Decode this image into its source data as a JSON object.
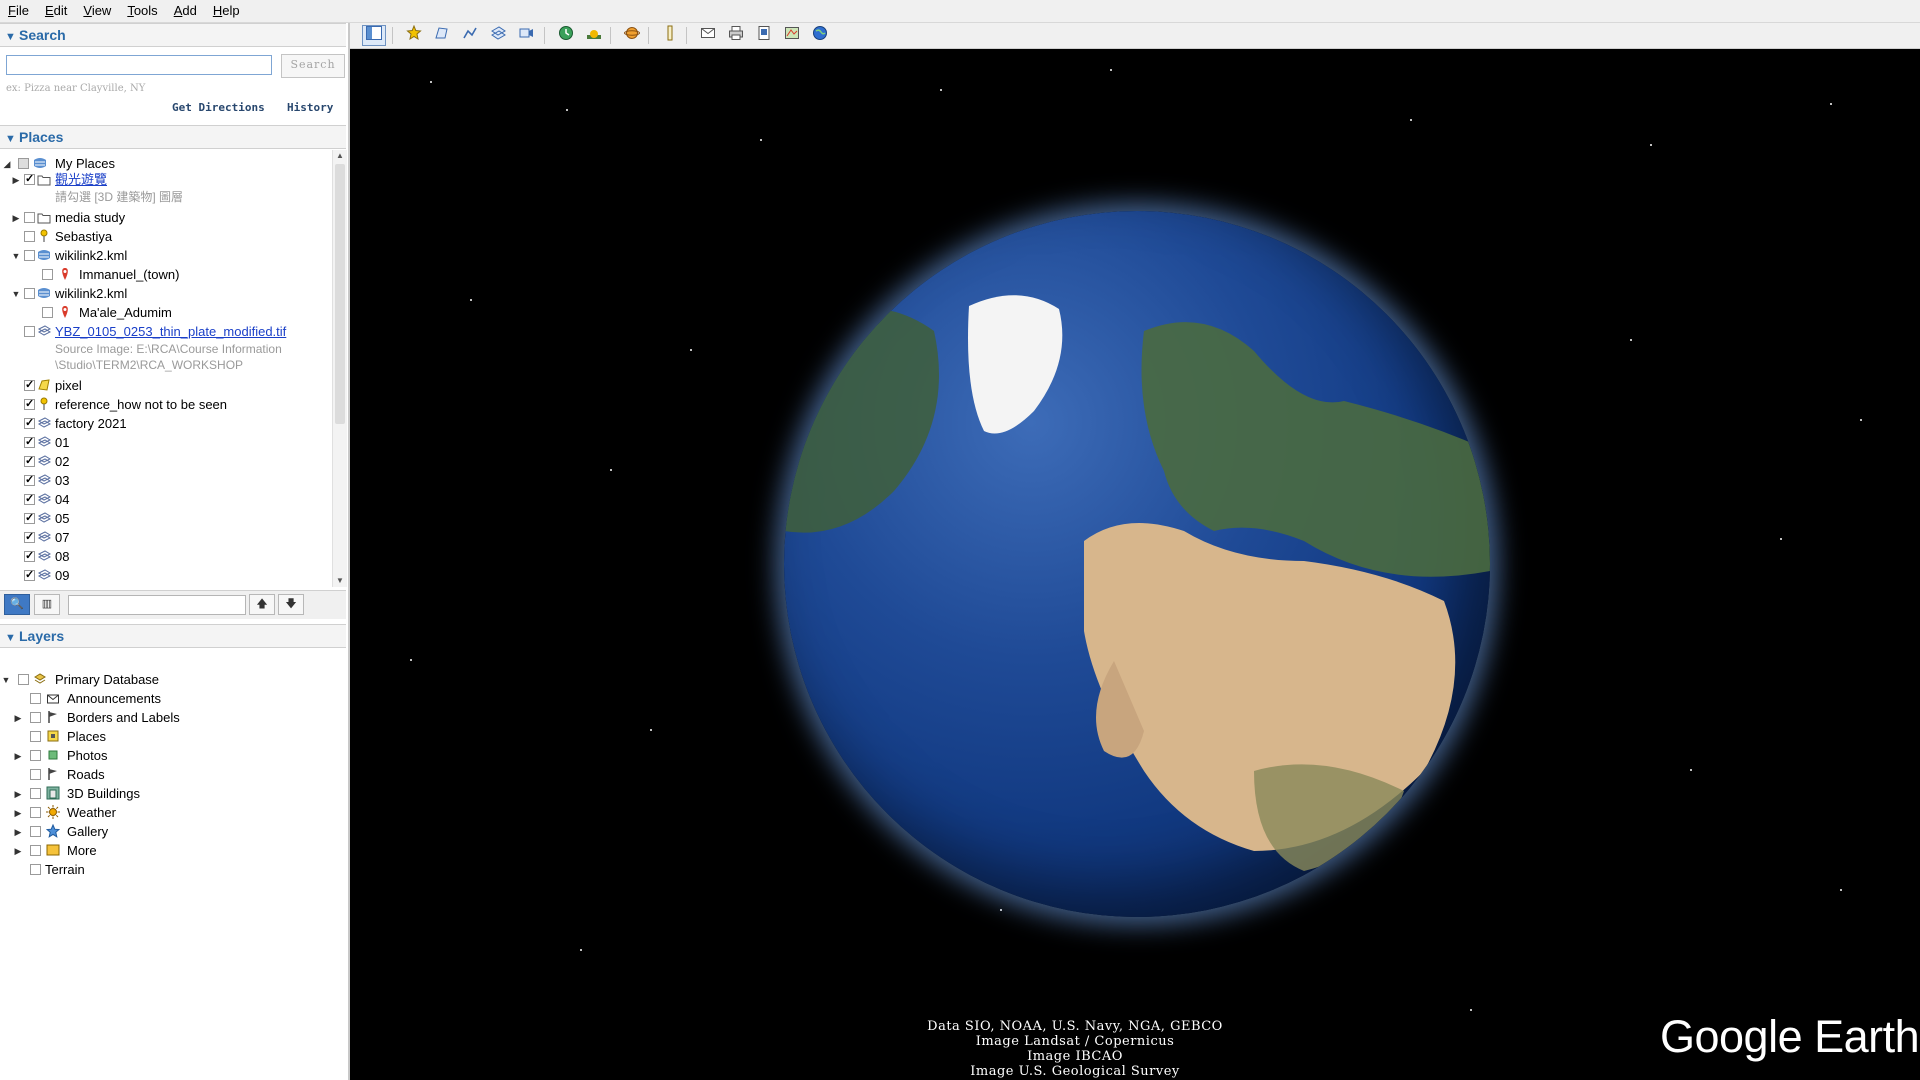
{
  "menubar": {
    "items": [
      "File",
      "Edit",
      "View",
      "Tools",
      "Add",
      "Help"
    ]
  },
  "search": {
    "header": "Search",
    "input_value": "",
    "search_button": "Search",
    "hint": "ex: Pizza near Clayville, NY",
    "get_directions": "Get Directions",
    "history": "History"
  },
  "places": {
    "header": "Places",
    "items": [
      {
        "label": "My Places"
      },
      {
        "label": "觀光遊覽"
      },
      {
        "label": "media study"
      },
      {
        "label": "Sebastiya"
      },
      {
        "label": "wikilink2.kml"
      },
      {
        "label": "Immanuel_(town)"
      },
      {
        "label": "wikilink2.kml"
      },
      {
        "label": "Ma'ale_Adumim"
      },
      {
        "label": "YBZ_0105_0253_thin_plate_modified.tif"
      },
      {
        "label": "pixel"
      },
      {
        "label": "reference_how not to be seen"
      },
      {
        "label": "factory 2021"
      },
      {
        "label": "01"
      },
      {
        "label": "02"
      },
      {
        "label": "03"
      },
      {
        "label": "04"
      },
      {
        "label": "05"
      },
      {
        "label": "07"
      },
      {
        "label": "08"
      },
      {
        "label": "09"
      }
    ],
    "tour_hint": "請勾選 [3D 建築物] 圖層",
    "source_line1": "Source Image: E:\\RCA\\Course Information",
    "source_line2": "\\Studio\\TERM2\\RCA_WORKSHOP"
  },
  "layers": {
    "header": "Layers",
    "items": [
      {
        "label": "Primary Database"
      },
      {
        "label": "Announcements"
      },
      {
        "label": "Borders and Labels"
      },
      {
        "label": "Places"
      },
      {
        "label": "Photos"
      },
      {
        "label": "Roads"
      },
      {
        "label": "3D Buildings"
      },
      {
        "label": "Weather"
      },
      {
        "label": "Gallery"
      },
      {
        "label": "More"
      },
      {
        "label": "Terrain"
      }
    ]
  },
  "toolbar_icons": [
    "sidebar-toggle-icon",
    "placemark-icon",
    "polygon-icon",
    "path-icon",
    "image-overlay-icon",
    "record-tour-icon",
    "historical-imagery-icon",
    "sunlight-icon",
    "planets-icon",
    "ruler-icon",
    "email-icon",
    "print-icon",
    "save-image-icon",
    "view-in-maps-icon",
    "earth-gallery-icon"
  ],
  "credits": {
    "line1": "Data SIO, NOAA, U.S. Navy, NGA, GEBCO",
    "line2": "Image Landsat / Copernicus",
    "line3": "Image IBCAO",
    "line4": "Image U.S. Geological Survey"
  },
  "logo": "Google Earth",
  "colors": {
    "header_text": "#2a6aa8",
    "link": "#1a3fc8",
    "space": "#000000",
    "ocean": "#1f4a96"
  }
}
